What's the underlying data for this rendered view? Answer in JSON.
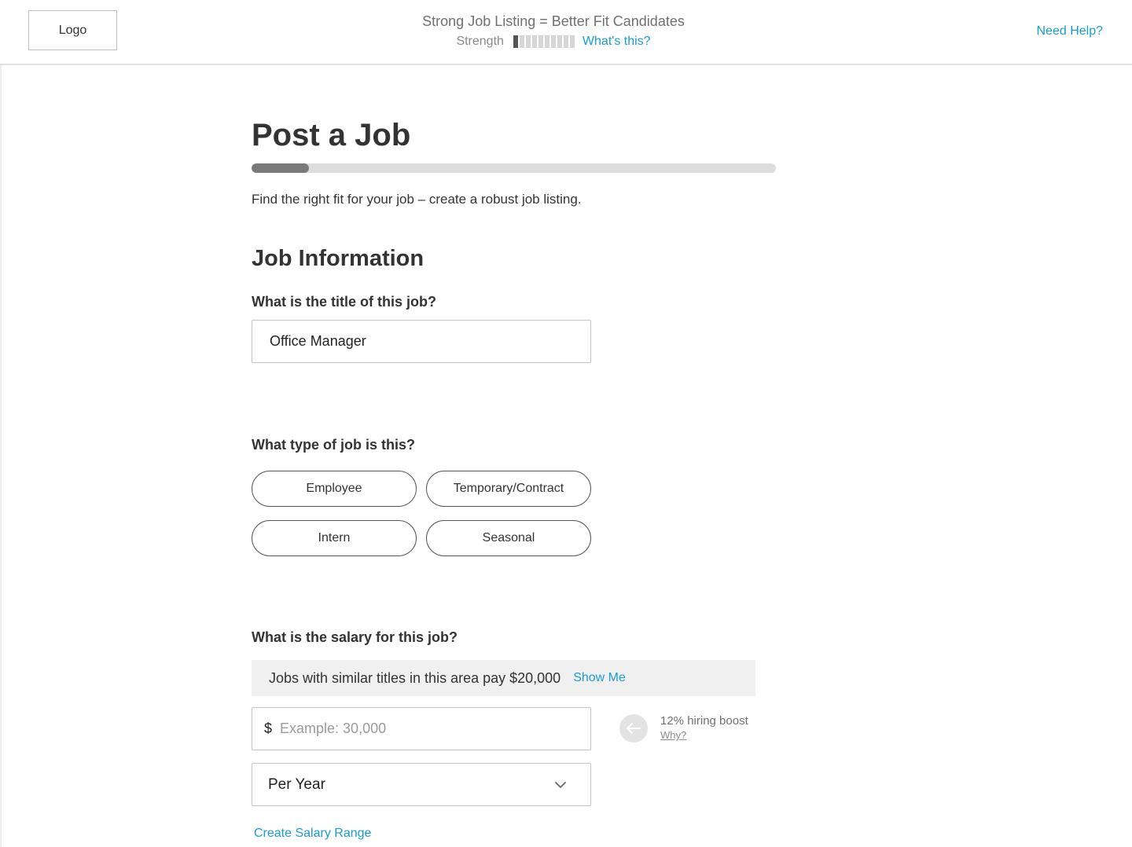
{
  "header": {
    "logo_label": "Logo",
    "tagline": "Strong Job Listing = Better Fit Candidates",
    "strength_label": "Strength",
    "strength_level": 0.1,
    "whats_this_label": "What's this?",
    "help_label": "Need Help?"
  },
  "page": {
    "title": "Post a Job",
    "progress": 0.11,
    "intro": "Find the right fit for your job – create a robust job listing."
  },
  "job_info": {
    "section_title": "Job Information",
    "title_question": "What is the title of this job?",
    "title_value": "Office Manager",
    "type_question": "What type of job is this?",
    "job_types": [
      "Employee",
      "Temporary/Contract",
      "Intern",
      "Seasonal"
    ],
    "salary_question": "What is the salary for this job?",
    "salary_hint": "Jobs with similar titles in this area pay $20,000",
    "show_me_label": "Show Me",
    "currency_symbol": "$",
    "salary_placeholder": "Example: 30,000",
    "boost_text": "12% hiring boost",
    "boost_why": "Why?",
    "pay_period": "Per Year",
    "salary_range_label": "Create Salary Range"
  },
  "icons": {
    "boost": "arrow-left-icon",
    "select": "chevron-down-icon"
  },
  "colors": {
    "link": "#1a9bd0",
    "progress_fill": "#7a7a7a",
    "progress_track": "#dddddd"
  }
}
